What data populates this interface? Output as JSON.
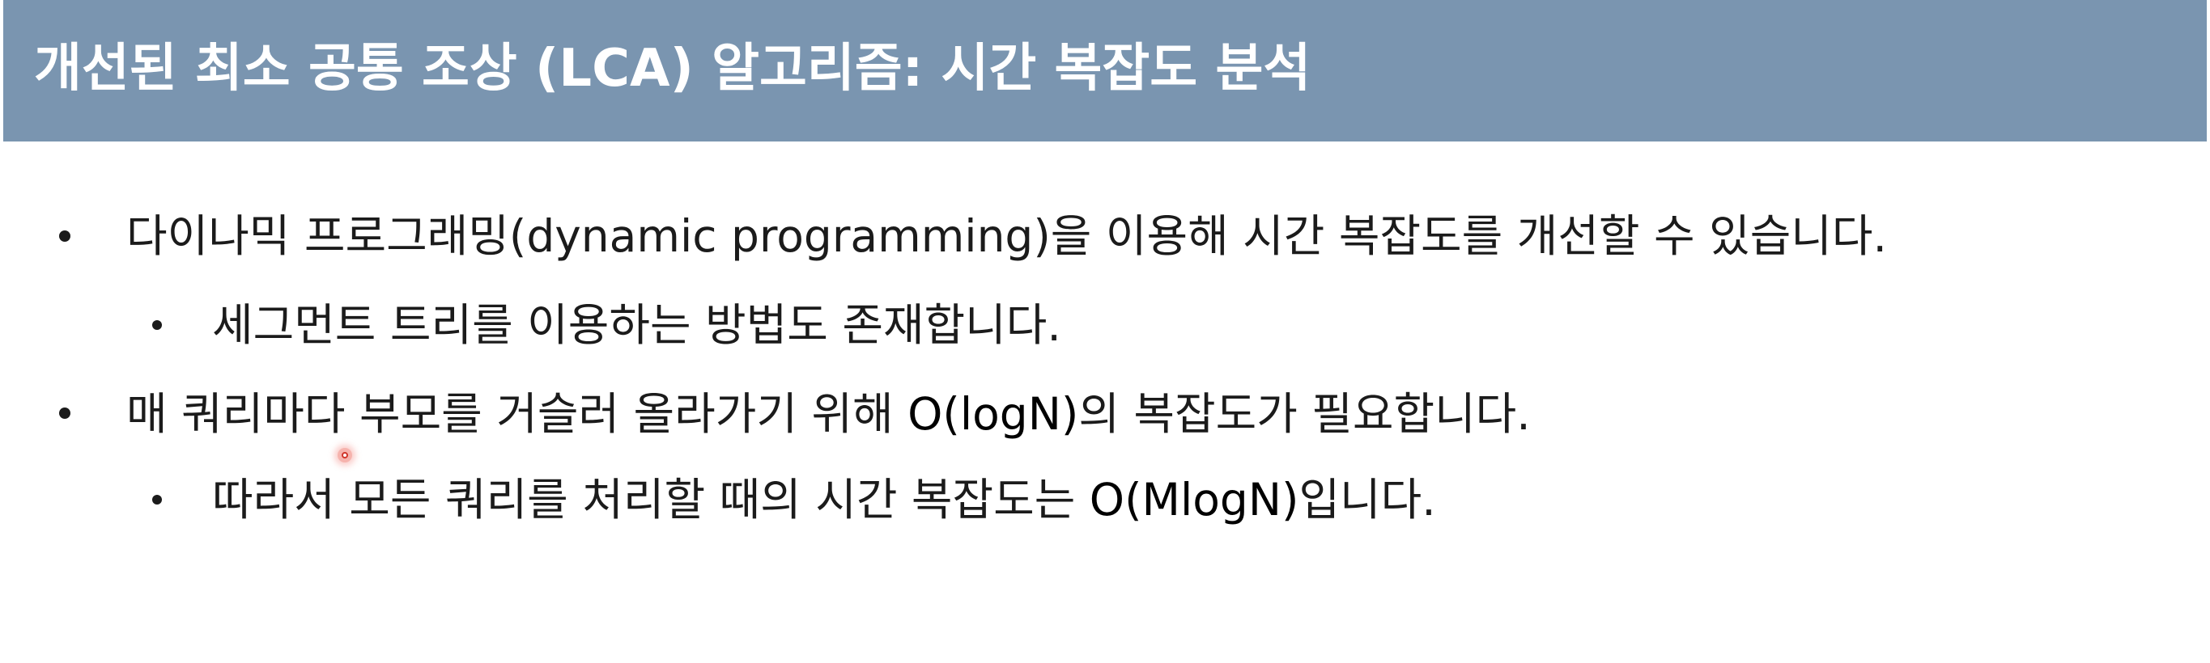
{
  "slide": {
    "title": "개선된 최소 공통 조상 (LCA) 알고리즘: 시간 복잡도 분석",
    "bullets": [
      {
        "prefix": "다이나믹 프로그래밍(dynamic programming)을 이용해 시간 복잡도를 개선할 수 있습니다.",
        "highlight": "",
        "suffix": ""
      },
      {
        "prefix": "세그먼트 트리를 이용하는 방법도 존재합니다.",
        "highlight": "",
        "suffix": ""
      },
      {
        "prefix": "매 쿼리마다 부모를 거슬러 올라가기 위해 ",
        "highlight": "O(logN)",
        "suffix": "의 복잡도가 필요합니다."
      },
      {
        "prefix": "따라서 모든 쿼리를 처리할 때의 시간 복잡도는 ",
        "highlight": "O(MlogN)",
        "suffix": "입니다."
      }
    ]
  },
  "colors": {
    "title_bar": "#7a95b0",
    "title_text": "#ffffff",
    "body_text": "#1b1b1b",
    "pointer": "#d0352a"
  },
  "icons": {
    "bullet": "bullet-dot",
    "pointer": "laser-pointer-icon"
  }
}
